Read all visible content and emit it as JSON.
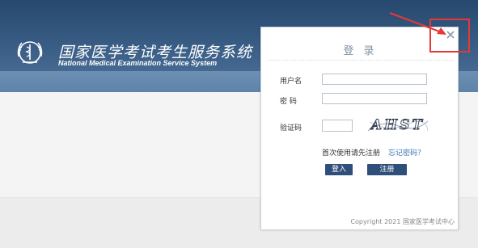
{
  "header": {
    "title": "国家医学考试考生服务系统",
    "subtitle": "National Medical Examination Service System"
  },
  "login": {
    "title": "登 录",
    "username_label": "用户名",
    "username_value": "",
    "password_label": "密 码",
    "password_value": "",
    "captcha_label": "验证码",
    "captcha_value": "",
    "captcha_text": "AHST",
    "register_hint": "首次使用请先注册",
    "forgot_password": "忘记密码？",
    "login_button": "登入",
    "register_button": "注册",
    "copyright": "Copyright 2021 国家医学考试中心"
  },
  "icons": {
    "logo": "medical-emblem-icon",
    "close": "close-icon",
    "annotation": "red-arrow-annotation"
  },
  "colors": {
    "header": "#3b5f87",
    "button": "#2f4e79",
    "link": "#3d74b6",
    "annotation": "#e53935"
  }
}
